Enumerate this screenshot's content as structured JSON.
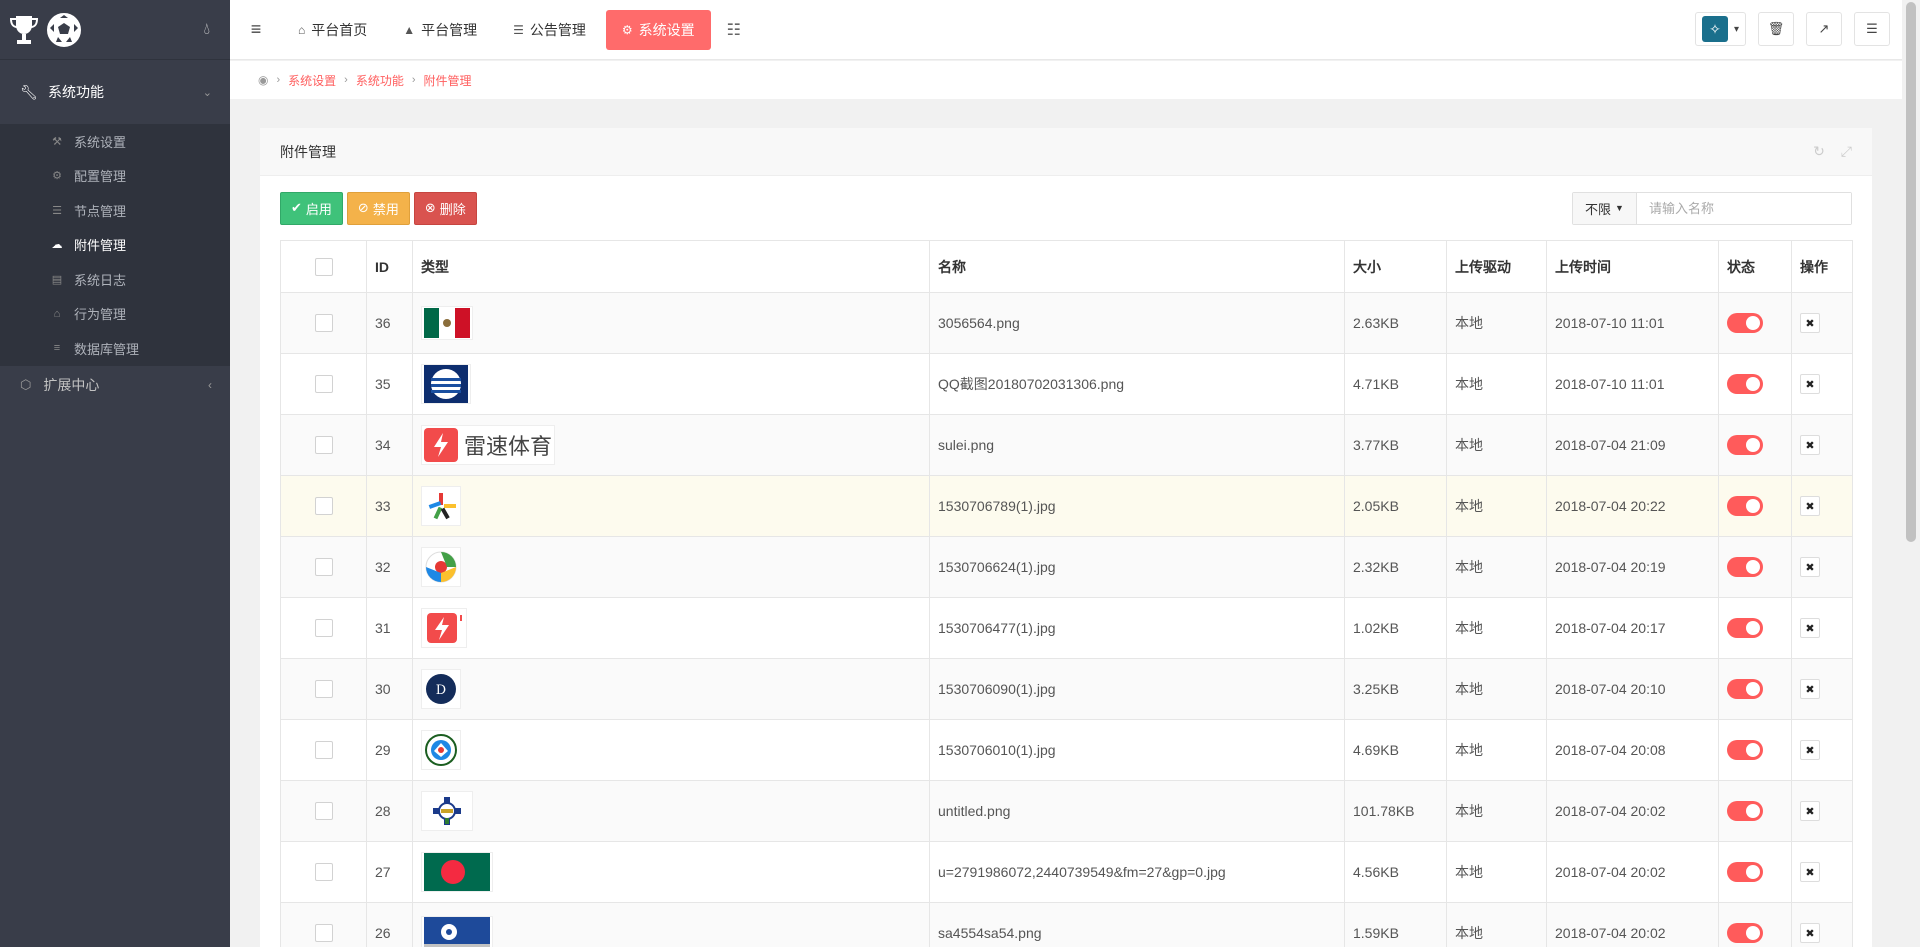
{
  "sidebar": {
    "group1_label": "系统功能",
    "items": [
      {
        "label": "系统设置",
        "icon": "wrench-icon"
      },
      {
        "label": "配置管理",
        "icon": "cogs-icon"
      },
      {
        "label": "节点管理",
        "icon": "list-icon"
      },
      {
        "label": "附件管理",
        "icon": "cloud-upload-icon"
      },
      {
        "label": "系统日志",
        "icon": "book-icon"
      },
      {
        "label": "行为管理",
        "icon": "bank-icon"
      },
      {
        "label": "数据库管理",
        "icon": "database-icon"
      }
    ],
    "group2_label": "扩展中心"
  },
  "topnav": {
    "items": [
      {
        "label": "平台首页",
        "icon": "home-icon"
      },
      {
        "label": "平台管理",
        "icon": "user-icon"
      },
      {
        "label": "公告管理",
        "icon": "list-alt-icon"
      },
      {
        "label": "系统设置",
        "icon": "gear-icon"
      }
    ],
    "active_index": 3
  },
  "breadcrumb": [
    "系统设置",
    "系统功能",
    "附件管理"
  ],
  "panel": {
    "title": "附件管理"
  },
  "toolbar": {
    "enable_label": "启用",
    "disable_label": "禁用",
    "delete_label": "删除",
    "filter_label": "不限",
    "search_placeholder": "请输入名称"
  },
  "table": {
    "headers": [
      "ID",
      "类型",
      "名称",
      "大小",
      "上传驱动",
      "上传时间",
      "状态",
      "操作"
    ],
    "rows": [
      {
        "id": "36",
        "name": "3056564.png",
        "size": "2.63KB",
        "driver": "本地",
        "time": "2018-07-10 11:01",
        "thumb": "mexico-flag"
      },
      {
        "id": "35",
        "name": "QQ截图20180702031306.png",
        "size": "4.71KB",
        "driver": "本地",
        "time": "2018-07-10 11:01",
        "thumb": "uruguay-badge"
      },
      {
        "id": "34",
        "name": "sulei.png",
        "size": "3.77KB",
        "driver": "本地",
        "time": "2018-07-04 21:09",
        "thumb": "leisu-logo",
        "thumb_text": "雷速体育"
      },
      {
        "id": "33",
        "name": "1530706789(1).jpg",
        "size": "2.05KB",
        "driver": "本地",
        "time": "2018-07-04 20:22",
        "thumb": "star-logo"
      },
      {
        "id": "32",
        "name": "1530706624(1).jpg",
        "size": "2.32KB",
        "driver": "本地",
        "time": "2018-07-04 20:19",
        "thumb": "ball-logo"
      },
      {
        "id": "31",
        "name": "1530706477(1).jpg",
        "size": "1.02KB",
        "driver": "本地",
        "time": "2018-07-04 20:17",
        "thumb": "leisu-icon"
      },
      {
        "id": "30",
        "name": "1530706090(1).jpg",
        "size": "3.25KB",
        "driver": "本地",
        "time": "2018-07-04 20:10",
        "thumb": "navy-badge"
      },
      {
        "id": "29",
        "name": "1530706010(1).jpg",
        "size": "4.69KB",
        "driver": "本地",
        "time": "2018-07-04 20:08",
        "thumb": "club-badge"
      },
      {
        "id": "28",
        "name": "untitled.png",
        "size": "101.78KB",
        "driver": "本地",
        "time": "2018-07-04 20:02",
        "thumb": "crest"
      },
      {
        "id": "27",
        "name": "u=2791986072,2440739549&fm=27&gp=0.jpg",
        "size": "4.56KB",
        "driver": "本地",
        "time": "2018-07-04 20:02",
        "thumb": "bangladesh-flag"
      },
      {
        "id": "26",
        "name": "sa4554sa54.png",
        "size": "1.59KB",
        "driver": "本地",
        "time": "2018-07-04 20:02",
        "thumb": "blue-ball"
      }
    ]
  },
  "colors": {
    "accent": "#ff6b6b",
    "sidebar_bg": "#393d49",
    "toggle_on": "#ff5b5b"
  }
}
